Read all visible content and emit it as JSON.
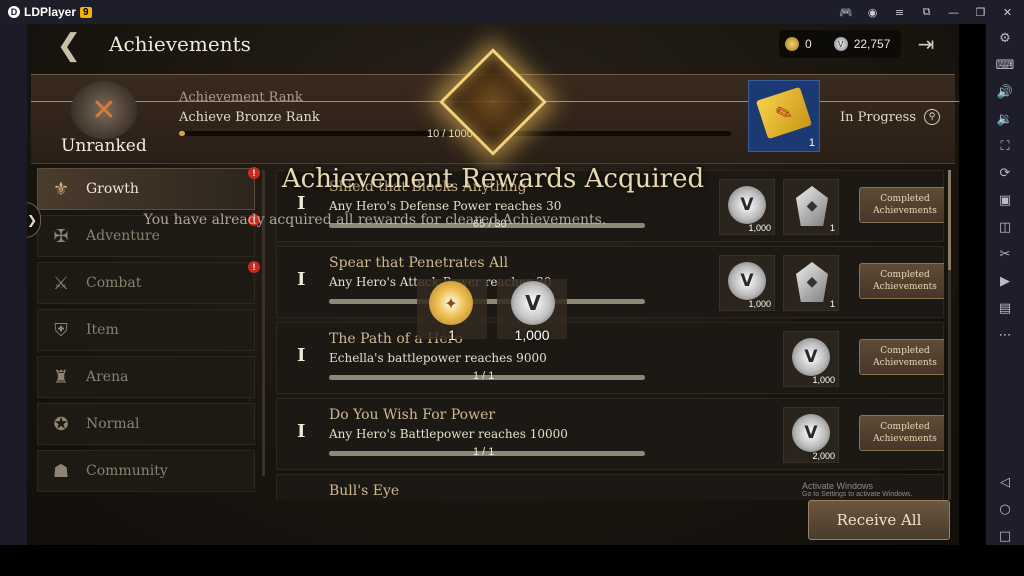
{
  "emulator": {
    "app_name": "LDPlayer",
    "version_badge": "9"
  },
  "header": {
    "title": "Achievements",
    "gold_amount": "0",
    "silver_amount": "22,757"
  },
  "rank": {
    "name": "Unranked",
    "label": "Achievement Rank",
    "description": "Achieve Bronze Rank",
    "progress_text": "10 / 1000",
    "progress_fraction": 0.01,
    "reward_qty": "1",
    "status": "In Progress"
  },
  "categories": [
    {
      "label": "Growth",
      "active": true,
      "alert": true,
      "icon": "growth-icon"
    },
    {
      "label": "Adventure",
      "active": false,
      "alert": true,
      "icon": "adventure-icon"
    },
    {
      "label": "Combat",
      "active": false,
      "alert": true,
      "icon": "combat-icon"
    },
    {
      "label": "Item",
      "active": false,
      "alert": false,
      "icon": "item-icon"
    },
    {
      "label": "Arena",
      "active": false,
      "alert": false,
      "icon": "arena-icon"
    },
    {
      "label": "Normal",
      "active": false,
      "alert": false,
      "icon": "medal-icon"
    },
    {
      "label": "Community",
      "active": false,
      "alert": false,
      "icon": "community-icon"
    }
  ],
  "achievements": [
    {
      "rank": "I",
      "title": "Shield that Blocks Anything",
      "desc": "Any Hero's Defense Power reaches 30",
      "progress_text": "65 / 30",
      "progress_fraction": 1.0,
      "rewards": [
        {
          "type": "silver",
          "qty": "1,000"
        },
        {
          "type": "stone",
          "qty": "1"
        }
      ],
      "button": "Completed Achievements"
    },
    {
      "rank": "I",
      "title": "Spear that Penetrates All",
      "desc": "Any Hero's Attack Power reaches 30",
      "progress_text": "",
      "progress_fraction": 1.0,
      "rewards": [
        {
          "type": "silver",
          "qty": "1,000"
        },
        {
          "type": "stone",
          "qty": "1"
        }
      ],
      "button": "Completed Achievements"
    },
    {
      "rank": "I",
      "title": "The Path of a Hero",
      "desc": "Echella's battlepower reaches 9000",
      "progress_text": "1 / 1",
      "progress_fraction": 1.0,
      "rewards": [
        {
          "type": "silver",
          "qty": "1,000"
        }
      ],
      "button": "Completed Achievements"
    },
    {
      "rank": "I",
      "title": "Do You Wish For Power",
      "desc": "Any Hero's Battlepower reaches 10000",
      "progress_text": "1 / 1",
      "progress_fraction": 1.0,
      "rewards": [
        {
          "type": "silver",
          "qty": "2,000"
        }
      ],
      "button": "Completed Achievements"
    },
    {
      "rank": "",
      "title": "Bull's Eye",
      "desc": "",
      "progress_text": "",
      "progress_fraction": 0,
      "rewards": [],
      "button": ""
    }
  ],
  "overlay": {
    "title": "Achievement Rewards Acquired",
    "subtitle": "You have already acquired all rewards for cleared Achievements.",
    "rewards": [
      {
        "type": "gold",
        "qty": "1"
      },
      {
        "type": "silver",
        "qty": "1,000"
      }
    ]
  },
  "footer": {
    "receive_all": "Receive All",
    "watermark_line1": "Activate Windows",
    "watermark_line2": "Go to Settings to activate Windows."
  }
}
